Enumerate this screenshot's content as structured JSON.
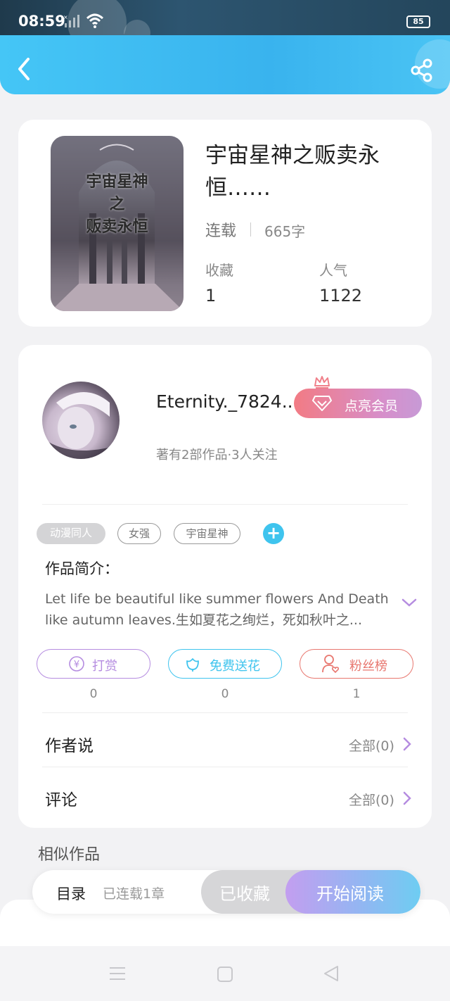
{
  "status_bar": {
    "time": "08:59",
    "battery": "85"
  },
  "book": {
    "title": "宇宙星神之贩卖永恒……",
    "cover_text": "宇宙星神\n之\n贩卖永恒",
    "status": "连载",
    "words": "665字",
    "stats": [
      {
        "label": "收藏",
        "value": "1"
      },
      {
        "label": "人气",
        "value": "1122"
      }
    ]
  },
  "author": {
    "name": "Eternity._7824...",
    "meta": "著有2部作品·3人关注",
    "vip_label": "点亮会员"
  },
  "tags": [
    "动漫同人",
    "女强",
    "宇宙星神"
  ],
  "intro": {
    "title": "作品简介：",
    "text": "Let life be beautiful like summer flowers And Death like autumn leaves.生如夏花之绚烂，死如秋叶之..."
  },
  "actions": [
    {
      "label": "打赏",
      "count": "0",
      "color": "#b58ce0",
      "icon": "yen-icon"
    },
    {
      "label": "免费送花",
      "count": "0",
      "color": "#3fc4ee",
      "icon": "flower-icon"
    },
    {
      "label": "粉丝榜",
      "count": "1",
      "color": "#e8776f",
      "icon": "fans-icon"
    }
  ],
  "rows": [
    {
      "title": "作者说",
      "right": "全部(0)"
    },
    {
      "title": "评论",
      "right": "全部(0)"
    }
  ],
  "similar_title": "相似作品",
  "bottom_bar": {
    "toc_label": "目录",
    "toc_count": "已连载1章",
    "fav_label": "已收藏",
    "read_label": "开始阅读"
  }
}
